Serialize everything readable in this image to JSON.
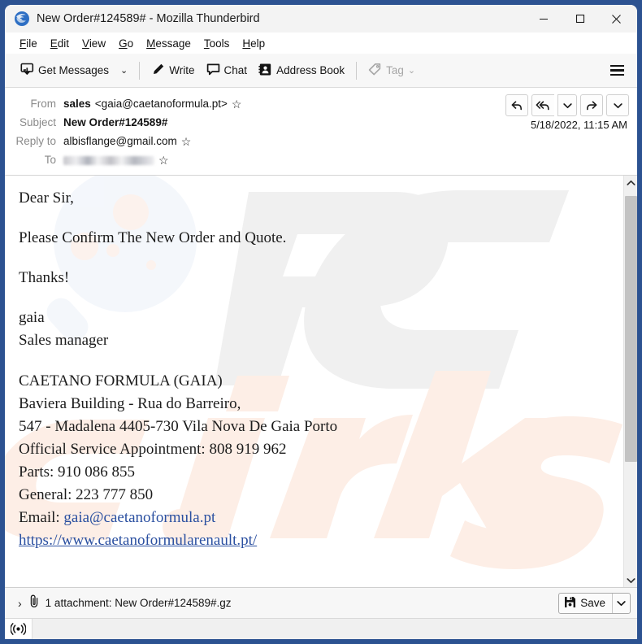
{
  "window": {
    "title": "New Order#124589# - Mozilla Thunderbird",
    "app_icon": "thunderbird-icon",
    "minimize_label": "–",
    "maximize_label": "☐",
    "close_label": "✕",
    "border_color": "#2c5291"
  },
  "menubar": {
    "items": [
      {
        "accesskey": "F",
        "rest": "ile"
      },
      {
        "accesskey": "E",
        "rest": "dit"
      },
      {
        "accesskey": "V",
        "rest": "iew"
      },
      {
        "accesskey": "G",
        "rest": "o"
      },
      {
        "accesskey": "M",
        "rest": "essage"
      },
      {
        "accesskey": "T",
        "rest": "ools"
      },
      {
        "accesskey": "H",
        "rest": "elp"
      }
    ]
  },
  "toolbar": {
    "get_messages_label": "Get Messages",
    "get_messages_chevron": "⌄",
    "write_label": "Write",
    "chat_label": "Chat",
    "address_book_label": "Address Book",
    "tag_label": "Tag",
    "tag_chevron": "⌄",
    "tag_disabled": true,
    "menu_label": "app-menu"
  },
  "message_header": {
    "from_label": "From",
    "from_name": "sales",
    "from_address": "<gaia@caetanoformula.pt>",
    "subject_label": "Subject",
    "subject_value": "New Order#124589#",
    "reply_to_label": "Reply to",
    "reply_to_value": "albisflange@gmail.com",
    "to_label": "To",
    "to_value": "",
    "to_redacted": true,
    "date": "5/18/2022, 11:15 AM",
    "star_glyph": "☆",
    "actions": {
      "reply": "↩",
      "reply_all": "↶↩",
      "reply_more": "⌄",
      "forward": "↪",
      "more": "⌄"
    }
  },
  "body": {
    "greeting": "Dear Sir,",
    "request": "Please Confirm The New Order and Quote.",
    "thanks": "Thanks!",
    "signer_name": "gaia",
    "signer_title": "Sales manager",
    "company": "CAETANO FORMULA (GAIA)",
    "address_line1": "Baviera Building - Rua do Barreiro,",
    "address_line2": "547 - Madalena 4405-730 Vila Nova De Gaia Porto",
    "service_line": "Official Service Appointment: 808 919 962",
    "parts_line": "Parts: 910 086 855",
    "general_line": "General: 223 777 850",
    "email_label": "Email:",
    "email_value": "gaia@caetanoformula.pt",
    "website": "https://www.caetanoformularenault.pt/",
    "link_color": "#2a4fa0",
    "watermark_text_primary": "PC",
    "watermark_text_secondary": "risk.com"
  },
  "scrollbar": {
    "up_glyph": "∧",
    "down_glyph": "∨"
  },
  "attachment_bar": {
    "expand_glyph": "›",
    "clip_icon": "paperclip-icon",
    "label": "1 attachment: New Order#124589#.gz",
    "save_label": "Save",
    "save_chevron": "⌄"
  },
  "statusbar": {
    "icon": "broadcast-icon",
    "text": ""
  }
}
